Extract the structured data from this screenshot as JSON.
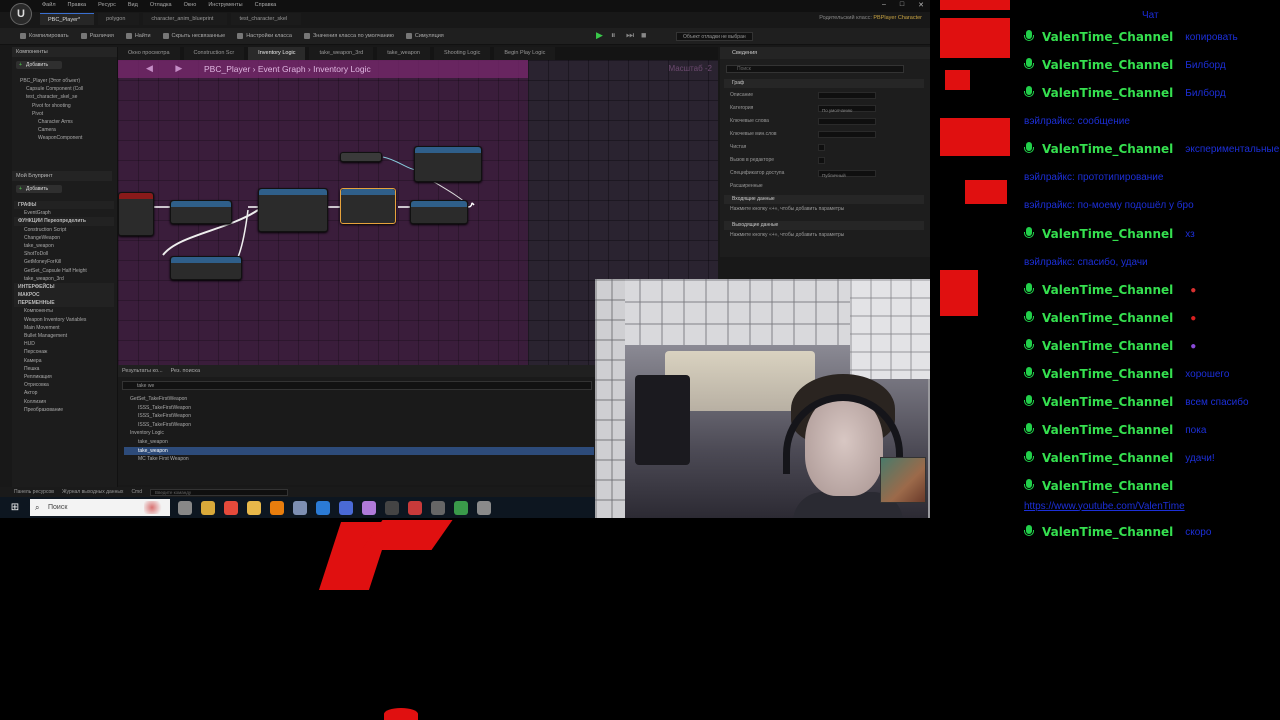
{
  "editor": {
    "menus": [
      "Файл",
      "Правка",
      "Ресурс",
      "Вид",
      "Отладка",
      "Окно",
      "Инструменты",
      "Справка"
    ],
    "doc_tabs": [
      {
        "label": "PBC_Player*",
        "active": true
      },
      {
        "label": "polygon",
        "active": false
      },
      {
        "label": "character_anim_blueprint",
        "active": false
      },
      {
        "label": "test_character_skel",
        "active": false
      }
    ],
    "parent_class_label": "Родительский класс:",
    "parent_class_value": "PBPlayer Character",
    "toolbar": [
      "Компилировать",
      "Различия",
      "Найти",
      "Скрыть несвязанные",
      "Настройки класса",
      "Значения класса по умолчанию",
      "Симуляция"
    ],
    "debug_object": "Объект отладки не выбран",
    "components_title": "Компоненты",
    "add_label": "Добавить",
    "search_placeholder": "Поиск",
    "components_tree": [
      "PBC_Player (Этот объект)",
      "Capsule Component (Coll",
      "test_character_skel_se",
      "Pivot for shooting",
      "Pivot",
      "Character Arms",
      "Camera",
      "WeaponComponent"
    ],
    "mybp_title": "Мой Блупринт",
    "mybp_tree": [
      {
        "label": "ГРАФЫ",
        "hdr": true
      },
      {
        "label": "EventGraph",
        "sel": false
      },
      {
        "label": "ФУНКЦИИ  Переопределить",
        "hdr": true
      },
      {
        "label": "Construction Script",
        "sel": false
      },
      {
        "label": "ChangeWeapon",
        "sel": false
      },
      {
        "label": "take_weapon",
        "sel": false
      },
      {
        "label": "ShotToDoll",
        "sel": false
      },
      {
        "label": "GetMoneyForKill",
        "sel": false
      },
      {
        "label": "GetSet_Capsule Half Height",
        "sel": false
      },
      {
        "label": "take_weapon_3rd",
        "sel": false
      },
      {
        "label": "ИНТЕРФЕЙСЫ",
        "hdr": true
      },
      {
        "label": "МАКРОС",
        "hdr": true
      },
      {
        "label": "ПЕРЕМЕННЫЕ",
        "hdr": true
      },
      {
        "label": "Компоненты",
        "sel": false
      },
      {
        "label": "Weapon Inventory Variables",
        "sel": false
      },
      {
        "label": "Main Movement",
        "sel": false
      },
      {
        "label": "Bullet Management",
        "sel": false
      },
      {
        "label": "HUD",
        "sel": false
      },
      {
        "label": "Персонаж",
        "sel": false
      },
      {
        "label": "Камера",
        "sel": false
      },
      {
        "label": "Пешка",
        "sel": false
      },
      {
        "label": "Репликация",
        "sel": false
      },
      {
        "label": "Отрисовка",
        "sel": false
      },
      {
        "label": "Актор",
        "sel": false
      },
      {
        "label": "Коллизия",
        "sel": false
      },
      {
        "label": "Преобразование",
        "sel": false
      }
    ],
    "graph_tabs": [
      {
        "label": "Окно просмотра",
        "active": false
      },
      {
        "label": "Construction Scr",
        "active": false
      },
      {
        "label": "Inventory Logic",
        "active": true
      },
      {
        "label": "take_weapon_3rd",
        "active": false
      },
      {
        "label": "take_weapon",
        "active": false
      },
      {
        "label": "Shooting Logic",
        "active": false
      },
      {
        "label": "Begin Play Logic",
        "active": false
      }
    ],
    "breadcrumb": "PBC_Player  ›  Event Graph  ›  Inventory Logic",
    "graph_watermark": "Масштаб -2",
    "details_title": "Сведения",
    "details_section_graph": "Граф",
    "details_rows": [
      "Описание",
      "Категория",
      "Ключевые слова",
      "Ключевые мин.слов",
      "Чистая",
      "Вызов в редакторе",
      "Спецификатор доступа",
      "Расширенные"
    ],
    "details_category_value": "По умолчанию",
    "details_access_value": "Публичный",
    "details_inputs": "Входящие данные",
    "details_inputs_hint": "Нажмите кнопку «+», чтобы добавить параметры",
    "details_outputs": "Выходящие данные",
    "details_outputs_hint": "Нажмите кнопку «+», чтобы добавить параметры",
    "results_tabs": [
      "Результаты ко...",
      "Рез. поиска"
    ],
    "results_query": "take we",
    "results_list": [
      {
        "label": "GetSet_TakeFirstWeapon",
        "sel": false
      },
      {
        "label": "ISSS_TakeFirstWeapon",
        "sel": false
      },
      {
        "label": "ISSS_TakeFirstWeapon",
        "sel": false
      },
      {
        "label": "ISSS_TakeFirstWeapon",
        "sel": false
      },
      {
        "label": "Inventory Logic",
        "sel": false
      },
      {
        "label": "take_weapon",
        "sel": false
      },
      {
        "label": "take_weapon",
        "sel": true
      },
      {
        "label": "MC Take First Weapon",
        "sel": false
      }
    ],
    "status_items": [
      "Панель ресурсов",
      "Журнал выходных данных",
      "Cmd"
    ],
    "cmd_placeholder": "Введите команду"
  },
  "taskbar": {
    "search_label": "Поиск",
    "icons": [
      {
        "name": "task-view-icon",
        "color": "#888888"
      },
      {
        "name": "file-explorer-icon",
        "color": "#d9a93a"
      },
      {
        "name": "chrome-icon",
        "color": "#e54a3b"
      },
      {
        "name": "folder-icon",
        "color": "#e8b84a"
      },
      {
        "name": "blender-icon",
        "color": "#e87d0d"
      },
      {
        "name": "app-icon",
        "color": "#7d8fb3"
      },
      {
        "name": "edge-icon",
        "color": "#2b7bd6"
      },
      {
        "name": "shield-icon",
        "color": "#4a6ad6"
      },
      {
        "name": "github-icon",
        "color": "#b07ad9"
      },
      {
        "name": "unreal-icon",
        "color": "#444444"
      },
      {
        "name": "app2-icon",
        "color": "#c93a3a"
      },
      {
        "name": "unreal2-icon",
        "color": "#666666"
      },
      {
        "name": "monitor-icon",
        "color": "#3a9a4a"
      },
      {
        "name": "settings-icon",
        "color": "#8a8a8a"
      }
    ]
  },
  "chat": {
    "header": "Чат",
    "accent_user": "#35e04f",
    "accent_text": "#1c2fd8",
    "messages": [
      {
        "type": "user",
        "user": "ValenTime_Channel",
        "text": "копировать"
      },
      {
        "type": "user",
        "user": "ValenTime_Channel",
        "text": "Билборд"
      },
      {
        "type": "user",
        "user": "ValenTime_Channel",
        "text": "Билборд"
      },
      {
        "type": "sys",
        "text": "вэйлрайкс: сообщение"
      },
      {
        "type": "user",
        "user": "ValenTime_Channel",
        "text": "экспериментальные"
      },
      {
        "type": "sys",
        "text": "вэйлрайкс: прототипирование"
      },
      {
        "type": "sys",
        "text": "вэйлрайкс: по-моему подошёл у бро"
      },
      {
        "type": "user",
        "user": "ValenTime_Channel",
        "text": "хз"
      },
      {
        "type": "sys",
        "text": "вэйлрайкс: спасибо, удачи"
      },
      {
        "type": "user",
        "user": "ValenTime_Channel",
        "text": "",
        "emote": "emote-red-face-icon",
        "emote_color": "#d83030"
      },
      {
        "type": "user",
        "user": "ValenTime_Channel",
        "text": "",
        "emote": "emote-red-heart-icon",
        "emote_color": "#d82020"
      },
      {
        "type": "user",
        "user": "ValenTime_Channel",
        "text": "",
        "emote": "emote-rainbow-icon",
        "emote_color": "#8a4ad8"
      },
      {
        "type": "user",
        "user": "ValenTime_Channel",
        "text": "хорошего"
      },
      {
        "type": "user",
        "user": "ValenTime_Channel",
        "text": "всем спасибо"
      },
      {
        "type": "user",
        "user": "ValenTime_Channel",
        "text": "пока"
      },
      {
        "type": "user",
        "user": "ValenTime_Channel",
        "text": "удачи!"
      },
      {
        "type": "user",
        "user": "ValenTime_Channel",
        "text": ""
      },
      {
        "type": "link",
        "text": "https://www.youtube.com/ValenTime"
      },
      {
        "type": "user",
        "user": "ValenTime_Channel",
        "text": "скоро"
      }
    ]
  }
}
